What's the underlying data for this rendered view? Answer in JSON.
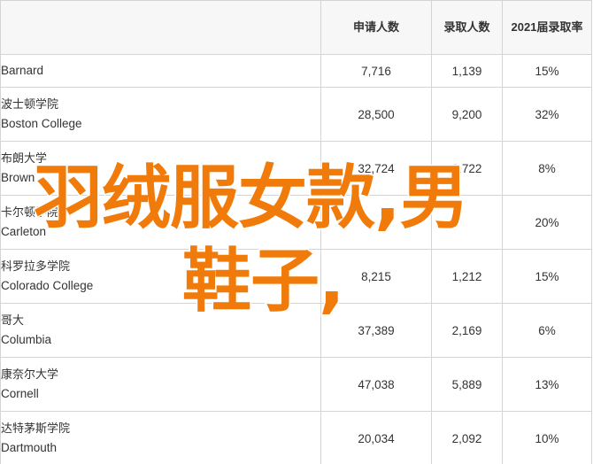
{
  "table": {
    "headers": [
      "",
      "申请人数",
      "录取人数",
      "2021届录取率"
    ],
    "rows": [
      {
        "cn": "",
        "en": "Barnard",
        "applicants": "7,716",
        "admitted": "1,139",
        "rate": "15%"
      },
      {
        "cn": "波士顿学院",
        "en": "Boston College",
        "applicants": "28,500",
        "admitted": "9,200",
        "rate": "32%"
      },
      {
        "cn": "布朗大学",
        "en": "Brown",
        "applicants": "32,724",
        "admitted": "2,722",
        "rate": "8%"
      },
      {
        "cn": "卡尔顿学院",
        "en": "Carleton",
        "applicants": "",
        "admitted": "",
        "rate": "20%"
      },
      {
        "cn": "科罗拉多学院",
        "en": "Colorado College",
        "applicants": "8,215",
        "admitted": "1,212",
        "rate": "15%"
      },
      {
        "cn": "哥大",
        "en": "Columbia",
        "applicants": "37,389",
        "admitted": "2,169",
        "rate": "6%"
      },
      {
        "cn": "康奈尔大学",
        "en": "Cornell",
        "applicants": "47,038",
        "admitted": "5,889",
        "rate": "13%"
      },
      {
        "cn": "达特茅斯学院",
        "en": "Dartmouth",
        "applicants": "20,034",
        "admitted": "2,092",
        "rate": "10%"
      }
    ]
  },
  "overlay": {
    "line1": "羽绒服女款,男",
    "line2": "鞋子,"
  },
  "colors": {
    "overlay_text": "#f07b0a",
    "header_bg": "#f7f7f7",
    "border": "#d4d4d4"
  }
}
